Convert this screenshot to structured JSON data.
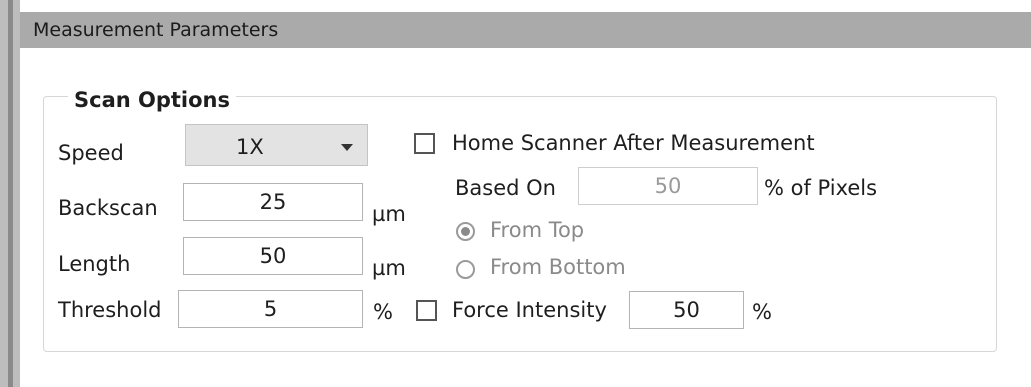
{
  "header": {
    "title": "Measurement Parameters"
  },
  "scan_options": {
    "title": "Scan Options",
    "speed": {
      "label": "Speed",
      "value": "1X"
    },
    "backscan": {
      "label": "Backscan",
      "value": "25",
      "unit": "µm"
    },
    "length": {
      "label": "Length",
      "value": "50",
      "unit": "µm"
    },
    "threshold": {
      "label": "Threshold",
      "value": "5",
      "unit": "%"
    },
    "home_scanner": {
      "label": "Home Scanner After Measurement",
      "checked": false
    },
    "based_on": {
      "label": "Based On",
      "value": "50",
      "unit": "% of Pixels"
    },
    "from_top": {
      "label": "From Top",
      "selected": true
    },
    "from_bottom": {
      "label": "From Bottom",
      "selected": false
    },
    "force_intensity": {
      "label": "Force Intensity",
      "checked": false,
      "value": "50",
      "unit": "%"
    }
  }
}
